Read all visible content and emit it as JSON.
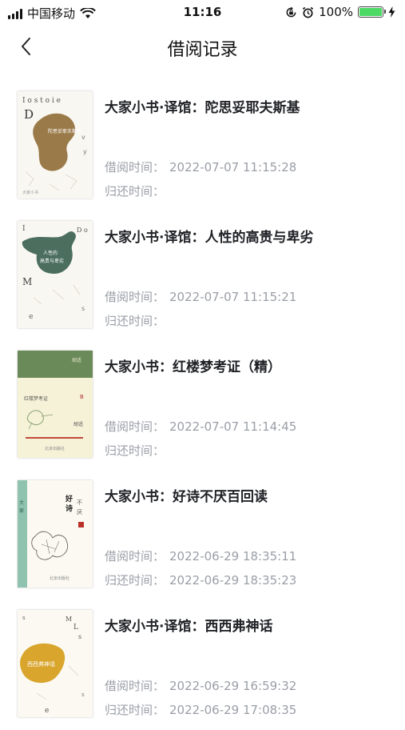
{
  "status_bar": {
    "carrier": "中国移动",
    "time": "11:16",
    "battery_percent": "100%",
    "icons": [
      "signal-icon",
      "wifi-icon",
      "lock-rotation-icon",
      "alarm-icon",
      "battery-icon",
      "charging-icon"
    ]
  },
  "nav": {
    "title": "借阅记录",
    "back_icon": "chevron-left-icon"
  },
  "labels": {
    "borrow": "借阅时间：",
    "return": "归还时间："
  },
  "records": [
    {
      "title": "大家小书·译馆：陀思妥耶夫斯基",
      "borrow_time": "2022-07-07 11:15:28",
      "return_time": "",
      "cover": {
        "accent": "#9a7a49",
        "style": "blob-brown"
      }
    },
    {
      "title": "大家小书·译馆：人性的高贵与卑劣",
      "borrow_time": "2022-07-07 11:15:21",
      "return_time": "",
      "cover": {
        "accent": "#4b6e5f",
        "style": "blob-green"
      }
    },
    {
      "title": "大家小书：红楼梦考证（精）",
      "borrow_time": "2022-07-07 11:14:45",
      "return_time": "",
      "cover": {
        "accent": "#6a8a5a",
        "style": "green-band"
      }
    },
    {
      "title": "大家小书：好诗不厌百回读",
      "borrow_time": "2022-06-29 18:35:11",
      "return_time": "2022-06-29 18:35:23",
      "cover": {
        "accent": "#8fc3b0",
        "style": "teal-stripe"
      }
    },
    {
      "title": "大家小书·译馆：西西弗神话",
      "borrow_time": "2022-06-29 16:59:32",
      "return_time": "2022-06-29 17:08:35",
      "cover": {
        "accent": "#d9a52c",
        "style": "blob-yellow"
      }
    }
  ]
}
